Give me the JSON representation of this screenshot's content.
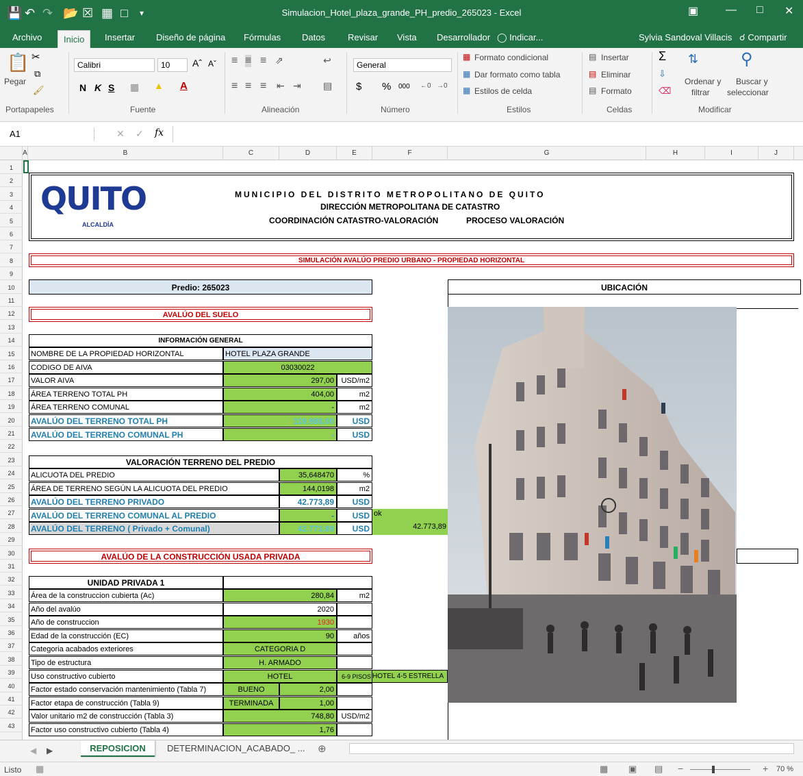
{
  "window": {
    "title": "Simulacion_Hotel_plaza_grande_PH_predio_265023 - Excel"
  },
  "menu": {
    "items": [
      "Archivo",
      "Inicio",
      "Insertar",
      "Diseño de página",
      "Fórmulas",
      "Datos",
      "Revisar",
      "Vista",
      "Desarrollador"
    ],
    "tell_me": "Indicar...",
    "user": "Sylvia Sandoval Villacis",
    "share": "Compartir"
  },
  "ribbon": {
    "paste": "Pegar",
    "clipboard": "Portapapeles",
    "font_name": "Calibri",
    "font_size": "10",
    "font_group": "Fuente",
    "bold": "N",
    "italic": "K",
    "underline": "S",
    "alignment": "Alineación",
    "number_format": "General",
    "number_group": "Número",
    "cond_format": "Formato condicional",
    "table_format": "Dar formato como tabla",
    "cell_styles": "Estilos de celda",
    "styles": "Estilos",
    "insert": "Insertar",
    "delete": "Eliminar",
    "format": "Formato",
    "cells": "Celdas",
    "sort_filter_1": "Ordenar y",
    "sort_filter_2": "filtrar",
    "find_1": "Buscar y",
    "find_2": "seleccionar",
    "modify": "Modificar"
  },
  "formula_bar": {
    "name_box": "A1",
    "formula": ""
  },
  "columns": [
    "A",
    "B",
    "C",
    "D",
    "E",
    "F",
    "G",
    "H",
    "I",
    "J"
  ],
  "rows": [
    "1",
    "2",
    "3",
    "4",
    "5",
    "6",
    "7",
    "8",
    "9",
    "10",
    "11",
    "12",
    "13",
    "14",
    "15",
    "16",
    "17",
    "18",
    "19",
    "20",
    "21",
    "22",
    "23",
    "24",
    "25",
    "26",
    "27",
    "28",
    "29",
    "30",
    "31",
    "32",
    "33",
    "34",
    "35",
    "36",
    "37",
    "38",
    "39",
    "40",
    "41",
    "42",
    "43"
  ],
  "header": {
    "logo": "QUITO",
    "logo_sub": "ALCALDÍA",
    "line1": "MUNICIPIO DEL DISTRITO METROPOLITANO DE QUITO",
    "line2": "DIRECCIÓN METROPOLITANA DE CATASTRO",
    "line3a": "COORDINACIÓN CATASTRO-VALORACIÓN",
    "line3b": "PROCESO VALORACIÓN"
  },
  "banner": "SIMULACIÓN AVALÚO PREDIO URBANO - PROPIEDAD HORIZONTAL",
  "predio": "Predio: 265023",
  "ubicacion": "UBICACIÓN",
  "avaluo_suelo": "AVALÚO DEL SUELO",
  "info": {
    "title": "INFORMACIÓN GENERAL",
    "rows": [
      {
        "label": "NOMBRE DE LA PROPIEDAD HORIZONTAL",
        "value": "HOTEL PLAZA GRANDE",
        "unit": ""
      },
      {
        "label": "CODIGO DE AIVA",
        "value": "03030022",
        "unit": ""
      },
      {
        "label": "VALOR AIVA",
        "value": "297,00",
        "unit": "USD/m2"
      },
      {
        "label": "ÁREA TERRENO TOTAL PH",
        "value": "404,00",
        "unit": "m2"
      },
      {
        "label": "ÁREA TERRENO COMUNAL",
        "value": "-",
        "unit": "m2"
      },
      {
        "label": "AVALÚO DEL TERRENO TOTAL PH",
        "value": "119.988,00",
        "unit": "USD"
      },
      {
        "label": "AVALÚO DEL TERRENO COMUNAL PH",
        "value": "-",
        "unit": "USD"
      }
    ]
  },
  "terreno": {
    "title": "VALORACIÓN TERRENO DEL PREDIO",
    "rows": [
      {
        "label": "ALICUOTA DEL PREDIO",
        "value": "35,648470",
        "unit": "%"
      },
      {
        "label": "ÁREA DE TERRENO SEGÚN LA ALICUOTA DEL PREDIO",
        "value": "144,0198",
        "unit": "m2"
      },
      {
        "label": "AVALÚO DEL TERRENO PRIVADO",
        "value": "42.773,89",
        "unit": "USD"
      },
      {
        "label": "AVALÚO DEL TERRENO COMUNAL AL PREDIO",
        "value": "-",
        "unit": "USD"
      },
      {
        "label": "AVALÚO DEL TERRENO ( Privado + Comunal)",
        "value": "42.773,89",
        "unit": "USD"
      }
    ],
    "ok": "ok",
    "side_value": "42.773,89"
  },
  "construccion_title": "AVALÚO DE LA CONSTRUCCIÓN USADA PRIVADA",
  "unidad": {
    "title": "UNIDAD PRIVADA 1",
    "rows": [
      {
        "label": "Área de la construccion cubierta (Ac)",
        "c": "",
        "d": "280,84",
        "e": "m2"
      },
      {
        "label": "Año del avalúo",
        "c": "",
        "d": "2020",
        "e": ""
      },
      {
        "label": "Año de construccion",
        "c": "",
        "d": "1930",
        "e": ""
      },
      {
        "label": "Edad de la construcción (EC)",
        "c": "",
        "d": "90",
        "e": "años"
      },
      {
        "label": "Categoria acabados exteriores",
        "c": "CATEGORIA D",
        "d": "",
        "e": ""
      },
      {
        "label": "Tipo de estructura",
        "c": "H. ARMADO",
        "d": "",
        "e": ""
      },
      {
        "label": "Uso constructivo cubierto",
        "c": "HOTEL",
        "d": "",
        "e": "6-9 PISOS",
        "f": "HOTEL 4-5 ESTRELLA"
      },
      {
        "label": "Factor estado conservación mantenimiento (Tabla 7)",
        "c": "BUENO",
        "d": "2,00",
        "e": ""
      },
      {
        "label": "Factor etapa de construcción (Tabla 9)",
        "c": "TERMINADA",
        "d": "1,00",
        "e": ""
      },
      {
        "label": "Valor unitario m2 de construcción (Tabla 3)",
        "c": "",
        "d": "748,80",
        "e": "USD/m2"
      },
      {
        "label": "Factor uso constructivo cubierto (Tabla 4)",
        "c": "",
        "d": "1,76",
        "e": ""
      }
    ]
  },
  "tabs": {
    "active": "REPOSICION",
    "other": "DETERMINACION_ACABADO_ ..."
  },
  "status": {
    "ready": "Listo",
    "zoom": "70 %"
  }
}
